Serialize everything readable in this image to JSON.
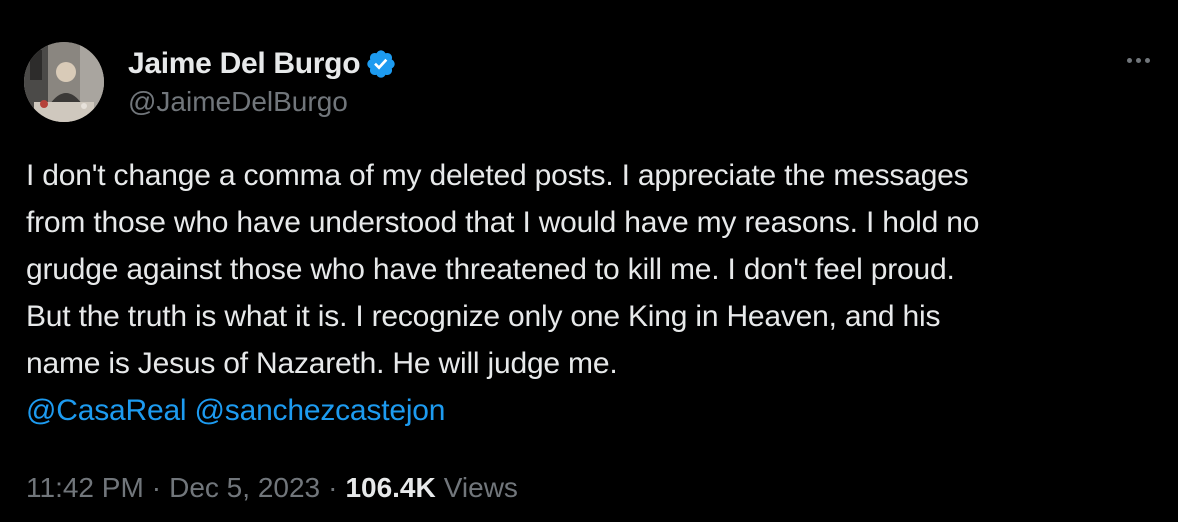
{
  "author": {
    "display_name": "Jaime Del Burgo",
    "handle": "@JaimeDelBurgo",
    "verified_icon": "verified-badge-icon",
    "avatar_icon": "profile-photo"
  },
  "more_icon": "more-horizontal-icon",
  "tweet": {
    "lines": [
      "I don't change a comma of my deleted posts. I appreciate the messages",
      "from those who have understood that I would have my reasons. I hold no",
      "grudge against those who have threatened to kill me. I don't feel proud.",
      "But the truth is what it is. I recognize only one King in Heaven, and his",
      "name is Jesus of Nazareth. He will judge me."
    ],
    "mentions": [
      "@CasaReal",
      "@sanchezcastejon"
    ]
  },
  "meta": {
    "time": "11:42 PM",
    "separator": "·",
    "date": "Dec 5, 2023",
    "views_count": "106.4K",
    "views_label": "Views"
  },
  "colors": {
    "background": "#000000",
    "text": "#e7e9ea",
    "muted": "#71767b",
    "link": "#1d9bf0",
    "verified": "#1d9bf0"
  }
}
